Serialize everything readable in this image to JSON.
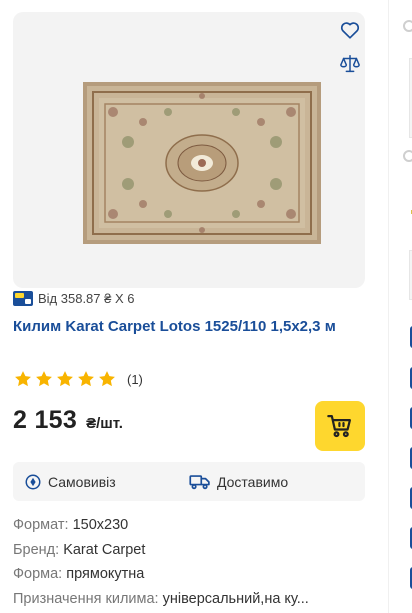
{
  "product": {
    "title": "Килим Karat Carpet Lotos 1525/110 1,5x2,3 м",
    "promo_text": "Від 358.87 ₴ X 6",
    "rating_count": "(1)",
    "rating_value": 5,
    "price": "2 153",
    "price_unit": "₴/шт.",
    "delivery": {
      "pickup": "Самовивіз",
      "shipping": "Доставимо"
    },
    "specs": [
      {
        "key": "Формат:",
        "value": "150x230"
      },
      {
        "key": "Бренд:",
        "value": "Karat Carpet"
      },
      {
        "key": "Форма:",
        "value": "прямокутна"
      },
      {
        "key": "Призначення килима:",
        "value": "універсальний,на ку..."
      }
    ]
  },
  "icons": {
    "favorite": "heart-icon",
    "compare": "scales-icon",
    "cart": "cart-icon",
    "pickup": "location-pin-icon",
    "shipping": "truck-icon",
    "promo": "installment-badge-icon",
    "star": "star-icon"
  },
  "colors": {
    "title_link": "#1a4e99",
    "cart_button": "#fed72e",
    "star": "#f8b400",
    "delivery_bg": "#f5f5f5"
  }
}
